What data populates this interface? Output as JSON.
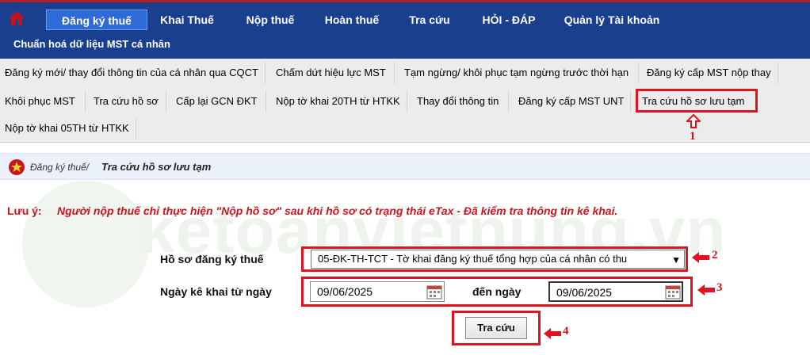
{
  "nav": {
    "items": [
      {
        "label": "Đăng ký thuế",
        "active": true
      },
      {
        "label": "Khai Thuế"
      },
      {
        "label": "Nộp thuế"
      },
      {
        "label": "Hoàn thuế"
      },
      {
        "label": "Tra cứu"
      },
      {
        "label": "HỎI - ĐÁP"
      },
      {
        "label": "Quản lý Tài khoản"
      }
    ],
    "second_row": "Chuẩn hoá dữ liệu MST cá nhân"
  },
  "submenu": {
    "row1": [
      "Đăng ký mới/ thay đổi thông tin của cá nhân qua CQCT",
      "Chấm dứt hiệu lực MST",
      "Tạm ngừng/ khôi phục tạm ngừng trước thời hạn",
      "Đăng ký cấp MST nộp thay"
    ],
    "row2": [
      "Khôi phục MST",
      "Tra cứu hồ sơ",
      "Cấp lại GCN ĐKT",
      "Nộp tờ khai 20TH từ HTKK",
      "Thay đổi thông tin",
      "Đăng ký cấp MST UNT",
      "Tra cứu hồ sơ lưu tạm"
    ],
    "row3": [
      "Nộp tờ khai 05TH từ HTKK"
    ]
  },
  "breadcrumb": {
    "home": "Đăng ký thuế/",
    "current": "Tra cứu hồ sơ lưu tạm"
  },
  "note": {
    "label": "Lưu ý:",
    "text": "Người nộp thuế chỉ thực hiện \"Nộp hồ sơ\" sau khi hồ sơ có trạng thái eTax - Đã kiểm tra thông tin kê khai."
  },
  "watermark": "ketoanvietnung.vn",
  "form": {
    "profile_label": "Hồ sơ đăng ký thuế",
    "profile_value": "05-ĐK-TH-TCT - Tờ khai đăng ký thuế tổng hợp của cá nhân có thu",
    "date_label": "Ngày kê khai từ ngày",
    "from_date": "09/06/2025",
    "to_label": "đến ngày",
    "to_date": "09/06/2025",
    "search_button": "Tra cứu"
  },
  "annotations": [
    "1",
    "2",
    "3",
    "4"
  ],
  "colors": {
    "nav_bg": "#1b3f8f",
    "active_tab": "#2f6bd6",
    "highlight": "#e0141e",
    "note": "#d0141e"
  }
}
